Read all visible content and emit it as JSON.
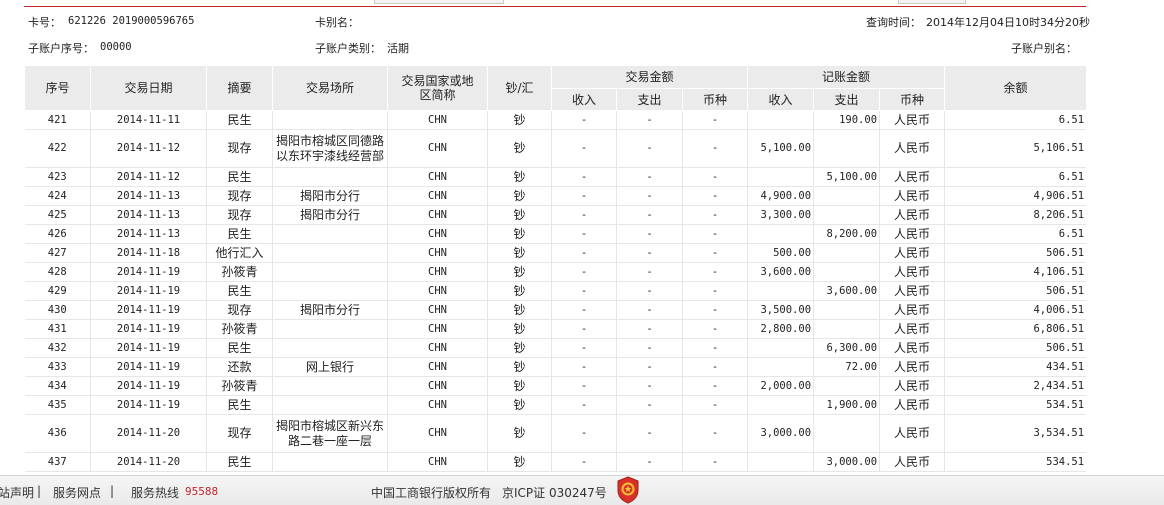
{
  "header": {
    "card_label": "卡号：",
    "card_number": "621226 2019000596765",
    "alias_label": "卡别名：",
    "query_time_label": "查询时间：",
    "query_time": "2014年12月04日10时34分20秒",
    "sub_seq_label": "子账户序号：",
    "sub_seq": "00000",
    "sub_type_label": "子账户类别：",
    "sub_type": "活期",
    "sub_alias_label": "子账户别名："
  },
  "table": {
    "headers": {
      "seq": "序号",
      "date": "交易日期",
      "summary": "摘要",
      "place": "交易场所",
      "country": "交易国家或地区简称",
      "cash_remit": "钞/汇",
      "trade_amount": "交易金额",
      "book_amount": "记账金额",
      "balance": "余额",
      "income": "收入",
      "expense": "支出",
      "currency": "币种"
    },
    "rows": [
      {
        "seq": "421",
        "date": "2014-11-11",
        "summary": "民生",
        "place": "",
        "country": "CHN",
        "cr": "钞",
        "t_in": "-",
        "t_out": "-",
        "t_cur": "-",
        "b_in": "",
        "b_out": "190.00",
        "b_cur": "人民币",
        "balance": "6.51"
      },
      {
        "seq": "422",
        "date": "2014-11-12",
        "summary": "现存",
        "place": "揭阳市榕城区同德路以东环宇漆线经营部",
        "country": "CHN",
        "cr": "钞",
        "t_in": "-",
        "t_out": "-",
        "t_cur": "-",
        "b_in": "5,100.00",
        "b_out": "",
        "b_cur": "人民币",
        "balance": "5,106.51"
      },
      {
        "seq": "423",
        "date": "2014-11-12",
        "summary": "民生",
        "place": "",
        "country": "CHN",
        "cr": "钞",
        "t_in": "-",
        "t_out": "-",
        "t_cur": "-",
        "b_in": "",
        "b_out": "5,100.00",
        "b_cur": "人民币",
        "balance": "6.51"
      },
      {
        "seq": "424",
        "date": "2014-11-13",
        "summary": "现存",
        "place": "揭阳市分行",
        "country": "CHN",
        "cr": "钞",
        "t_in": "-",
        "t_out": "-",
        "t_cur": "-",
        "b_in": "4,900.00",
        "b_out": "",
        "b_cur": "人民币",
        "balance": "4,906.51"
      },
      {
        "seq": "425",
        "date": "2014-11-13",
        "summary": "现存",
        "place": "揭阳市分行",
        "country": "CHN",
        "cr": "钞",
        "t_in": "-",
        "t_out": "-",
        "t_cur": "-",
        "b_in": "3,300.00",
        "b_out": "",
        "b_cur": "人民币",
        "balance": "8,206.51"
      },
      {
        "seq": "426",
        "date": "2014-11-13",
        "summary": "民生",
        "place": "",
        "country": "CHN",
        "cr": "钞",
        "t_in": "-",
        "t_out": "-",
        "t_cur": "-",
        "b_in": "",
        "b_out": "8,200.00",
        "b_cur": "人民币",
        "balance": "6.51"
      },
      {
        "seq": "427",
        "date": "2014-11-18",
        "summary": "他行汇入",
        "place": "",
        "country": "CHN",
        "cr": "钞",
        "t_in": "-",
        "t_out": "-",
        "t_cur": "-",
        "b_in": "500.00",
        "b_out": "",
        "b_cur": "人民币",
        "balance": "506.51"
      },
      {
        "seq": "428",
        "date": "2014-11-19",
        "summary": "孙筱青",
        "place": "",
        "country": "CHN",
        "cr": "钞",
        "t_in": "-",
        "t_out": "-",
        "t_cur": "-",
        "b_in": "3,600.00",
        "b_out": "",
        "b_cur": "人民币",
        "balance": "4,106.51"
      },
      {
        "seq": "429",
        "date": "2014-11-19",
        "summary": "民生",
        "place": "",
        "country": "CHN",
        "cr": "钞",
        "t_in": "-",
        "t_out": "-",
        "t_cur": "-",
        "b_in": "",
        "b_out": "3,600.00",
        "b_cur": "人民币",
        "balance": "506.51"
      },
      {
        "seq": "430",
        "date": "2014-11-19",
        "summary": "现存",
        "place": "揭阳市分行",
        "country": "CHN",
        "cr": "钞",
        "t_in": "-",
        "t_out": "-",
        "t_cur": "-",
        "b_in": "3,500.00",
        "b_out": "",
        "b_cur": "人民币",
        "balance": "4,006.51"
      },
      {
        "seq": "431",
        "date": "2014-11-19",
        "summary": "孙筱青",
        "place": "",
        "country": "CHN",
        "cr": "钞",
        "t_in": "-",
        "t_out": "-",
        "t_cur": "-",
        "b_in": "2,800.00",
        "b_out": "",
        "b_cur": "人民币",
        "balance": "6,806.51"
      },
      {
        "seq": "432",
        "date": "2014-11-19",
        "summary": "民生",
        "place": "",
        "country": "CHN",
        "cr": "钞",
        "t_in": "-",
        "t_out": "-",
        "t_cur": "-",
        "b_in": "",
        "b_out": "6,300.00",
        "b_cur": "人民币",
        "balance": "506.51"
      },
      {
        "seq": "433",
        "date": "2014-11-19",
        "summary": "还款",
        "place": "网上银行",
        "country": "CHN",
        "cr": "钞",
        "t_in": "-",
        "t_out": "-",
        "t_cur": "-",
        "b_in": "",
        "b_out": "72.00",
        "b_cur": "人民币",
        "balance": "434.51"
      },
      {
        "seq": "434",
        "date": "2014-11-19",
        "summary": "孙筱青",
        "place": "",
        "country": "CHN",
        "cr": "钞",
        "t_in": "-",
        "t_out": "-",
        "t_cur": "-",
        "b_in": "2,000.00",
        "b_out": "",
        "b_cur": "人民币",
        "balance": "2,434.51"
      },
      {
        "seq": "435",
        "date": "2014-11-19",
        "summary": "民生",
        "place": "",
        "country": "CHN",
        "cr": "钞",
        "t_in": "-",
        "t_out": "-",
        "t_cur": "-",
        "b_in": "",
        "b_out": "1,900.00",
        "b_cur": "人民币",
        "balance": "534.51"
      },
      {
        "seq": "436",
        "date": "2014-11-20",
        "summary": "现存",
        "place": "揭阳市榕城区新兴东路二巷一座一层",
        "country": "CHN",
        "cr": "钞",
        "t_in": "-",
        "t_out": "-",
        "t_cur": "-",
        "b_in": "3,000.00",
        "b_out": "",
        "b_cur": "人民币",
        "balance": "3,534.51"
      },
      {
        "seq": "437",
        "date": "2014-11-20",
        "summary": "民生",
        "place": "",
        "country": "CHN",
        "cr": "钞",
        "t_in": "-",
        "t_out": "-",
        "t_cur": "-",
        "b_in": "",
        "b_out": "3,000.00",
        "b_cur": "人民币",
        "balance": "534.51"
      }
    ]
  },
  "footer": {
    "disclaimer": "站声明",
    "sep1": "|",
    "outlets": "服务网点",
    "sep2": "|",
    "hotline_label": "服务热线",
    "hotline": "95588",
    "copyright": "中国工商银行版权所有",
    "icp": "京ICP证 030247号"
  },
  "colors": {
    "accent_red": "#c5262a",
    "header_gray": "#ebebeb"
  },
  "icons": {
    "emblem": "police-badge-icon"
  }
}
